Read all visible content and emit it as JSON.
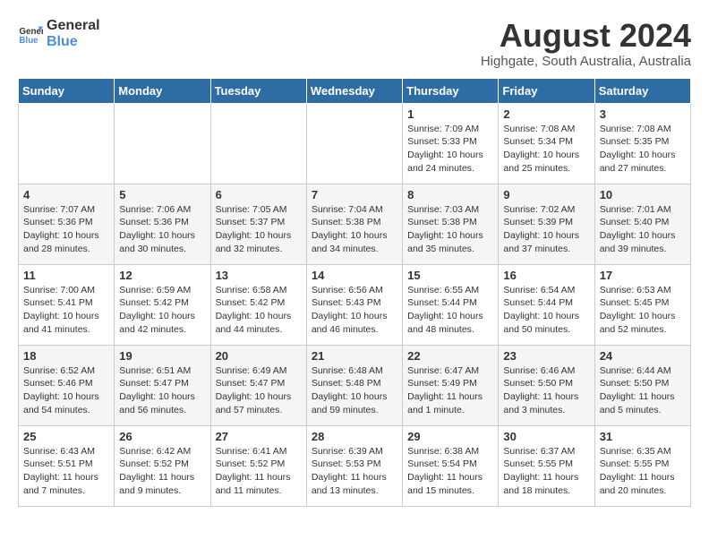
{
  "header": {
    "logo_line1": "General",
    "logo_line2": "Blue",
    "month_year": "August 2024",
    "location": "Highgate, South Australia, Australia"
  },
  "days_of_week": [
    "Sunday",
    "Monday",
    "Tuesday",
    "Wednesday",
    "Thursday",
    "Friday",
    "Saturday"
  ],
  "weeks": [
    [
      {
        "day": "",
        "info": ""
      },
      {
        "day": "",
        "info": ""
      },
      {
        "day": "",
        "info": ""
      },
      {
        "day": "",
        "info": ""
      },
      {
        "day": "1",
        "info": "Sunrise: 7:09 AM\nSunset: 5:33 PM\nDaylight: 10 hours and 24 minutes."
      },
      {
        "day": "2",
        "info": "Sunrise: 7:08 AM\nSunset: 5:34 PM\nDaylight: 10 hours and 25 minutes."
      },
      {
        "day": "3",
        "info": "Sunrise: 7:08 AM\nSunset: 5:35 PM\nDaylight: 10 hours and 27 minutes."
      }
    ],
    [
      {
        "day": "4",
        "info": "Sunrise: 7:07 AM\nSunset: 5:36 PM\nDaylight: 10 hours and 28 minutes."
      },
      {
        "day": "5",
        "info": "Sunrise: 7:06 AM\nSunset: 5:36 PM\nDaylight: 10 hours and 30 minutes."
      },
      {
        "day": "6",
        "info": "Sunrise: 7:05 AM\nSunset: 5:37 PM\nDaylight: 10 hours and 32 minutes."
      },
      {
        "day": "7",
        "info": "Sunrise: 7:04 AM\nSunset: 5:38 PM\nDaylight: 10 hours and 34 minutes."
      },
      {
        "day": "8",
        "info": "Sunrise: 7:03 AM\nSunset: 5:38 PM\nDaylight: 10 hours and 35 minutes."
      },
      {
        "day": "9",
        "info": "Sunrise: 7:02 AM\nSunset: 5:39 PM\nDaylight: 10 hours and 37 minutes."
      },
      {
        "day": "10",
        "info": "Sunrise: 7:01 AM\nSunset: 5:40 PM\nDaylight: 10 hours and 39 minutes."
      }
    ],
    [
      {
        "day": "11",
        "info": "Sunrise: 7:00 AM\nSunset: 5:41 PM\nDaylight: 10 hours and 41 minutes."
      },
      {
        "day": "12",
        "info": "Sunrise: 6:59 AM\nSunset: 5:42 PM\nDaylight: 10 hours and 42 minutes."
      },
      {
        "day": "13",
        "info": "Sunrise: 6:58 AM\nSunset: 5:42 PM\nDaylight: 10 hours and 44 minutes."
      },
      {
        "day": "14",
        "info": "Sunrise: 6:56 AM\nSunset: 5:43 PM\nDaylight: 10 hours and 46 minutes."
      },
      {
        "day": "15",
        "info": "Sunrise: 6:55 AM\nSunset: 5:44 PM\nDaylight: 10 hours and 48 minutes."
      },
      {
        "day": "16",
        "info": "Sunrise: 6:54 AM\nSunset: 5:44 PM\nDaylight: 10 hours and 50 minutes."
      },
      {
        "day": "17",
        "info": "Sunrise: 6:53 AM\nSunset: 5:45 PM\nDaylight: 10 hours and 52 minutes."
      }
    ],
    [
      {
        "day": "18",
        "info": "Sunrise: 6:52 AM\nSunset: 5:46 PM\nDaylight: 10 hours and 54 minutes."
      },
      {
        "day": "19",
        "info": "Sunrise: 6:51 AM\nSunset: 5:47 PM\nDaylight: 10 hours and 56 minutes."
      },
      {
        "day": "20",
        "info": "Sunrise: 6:49 AM\nSunset: 5:47 PM\nDaylight: 10 hours and 57 minutes."
      },
      {
        "day": "21",
        "info": "Sunrise: 6:48 AM\nSunset: 5:48 PM\nDaylight: 10 hours and 59 minutes."
      },
      {
        "day": "22",
        "info": "Sunrise: 6:47 AM\nSunset: 5:49 PM\nDaylight: 11 hours and 1 minute."
      },
      {
        "day": "23",
        "info": "Sunrise: 6:46 AM\nSunset: 5:50 PM\nDaylight: 11 hours and 3 minutes."
      },
      {
        "day": "24",
        "info": "Sunrise: 6:44 AM\nSunset: 5:50 PM\nDaylight: 11 hours and 5 minutes."
      }
    ],
    [
      {
        "day": "25",
        "info": "Sunrise: 6:43 AM\nSunset: 5:51 PM\nDaylight: 11 hours and 7 minutes."
      },
      {
        "day": "26",
        "info": "Sunrise: 6:42 AM\nSunset: 5:52 PM\nDaylight: 11 hours and 9 minutes."
      },
      {
        "day": "27",
        "info": "Sunrise: 6:41 AM\nSunset: 5:52 PM\nDaylight: 11 hours and 11 minutes."
      },
      {
        "day": "28",
        "info": "Sunrise: 6:39 AM\nSunset: 5:53 PM\nDaylight: 11 hours and 13 minutes."
      },
      {
        "day": "29",
        "info": "Sunrise: 6:38 AM\nSunset: 5:54 PM\nDaylight: 11 hours and 15 minutes."
      },
      {
        "day": "30",
        "info": "Sunrise: 6:37 AM\nSunset: 5:55 PM\nDaylight: 11 hours and 18 minutes."
      },
      {
        "day": "31",
        "info": "Sunrise: 6:35 AM\nSunset: 5:55 PM\nDaylight: 11 hours and 20 minutes."
      }
    ]
  ]
}
